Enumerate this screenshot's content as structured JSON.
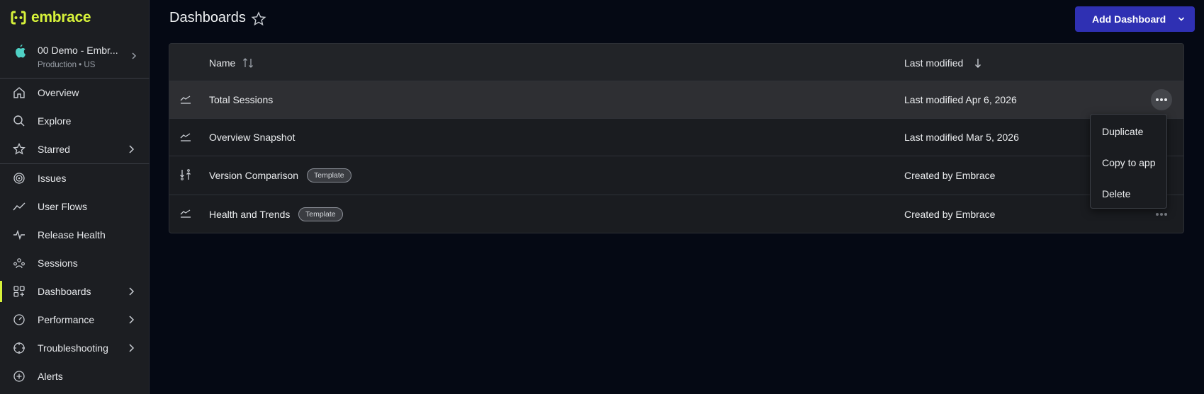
{
  "brand": {
    "name": "embrace",
    "accent": "#d7f23a"
  },
  "app": {
    "name": "00 Demo - Embr...",
    "environment": "Production • US",
    "icon": "apple-icon"
  },
  "sidebar": {
    "items": [
      {
        "label": "Overview",
        "icon": "home-icon",
        "chevron": false
      },
      {
        "label": "Explore",
        "icon": "search-icon",
        "chevron": false
      },
      {
        "label": "Starred",
        "icon": "star-icon",
        "chevron": true
      },
      {
        "label": "Issues",
        "icon": "radar-icon",
        "chevron": false
      },
      {
        "label": "User Flows",
        "icon": "trend-line-icon",
        "chevron": false
      },
      {
        "label": "Release Health",
        "icon": "pulse-icon",
        "chevron": false
      },
      {
        "label": "Sessions",
        "icon": "users-icon",
        "chevron": false
      },
      {
        "label": "Dashboards",
        "icon": "dashboard-grid-icon",
        "chevron": true,
        "active": true
      },
      {
        "label": "Performance",
        "icon": "gauge-icon",
        "chevron": true
      },
      {
        "label": "Troubleshooting",
        "icon": "crosshair-icon",
        "chevron": true
      },
      {
        "label": "Alerts",
        "icon": "alert-icon",
        "chevron": false
      }
    ]
  },
  "header": {
    "title": "Dashboards",
    "add_button": "Add Dashboard",
    "add_button_color": "#2f30b3"
  },
  "table": {
    "columns": {
      "name": "Name",
      "last_modified": "Last modified"
    },
    "rows": [
      {
        "name": "Total Sessions",
        "badge": "",
        "modified": "Last modified Apr 6, 2026",
        "icon": "chart-line-icon"
      },
      {
        "name": "Overview Snapshot",
        "badge": "",
        "modified": "Last modified Mar 5, 2026",
        "icon": "chart-line-icon"
      },
      {
        "name": "Version Comparison",
        "badge": "Template",
        "modified": "Created by Embrace",
        "icon": "compare-icon"
      },
      {
        "name": "Health and Trends",
        "badge": "Template",
        "modified": "Created by Embrace",
        "icon": "chart-line-icon"
      }
    ]
  },
  "row_menu": {
    "items": [
      "Duplicate",
      "Copy to app",
      "Delete"
    ]
  }
}
